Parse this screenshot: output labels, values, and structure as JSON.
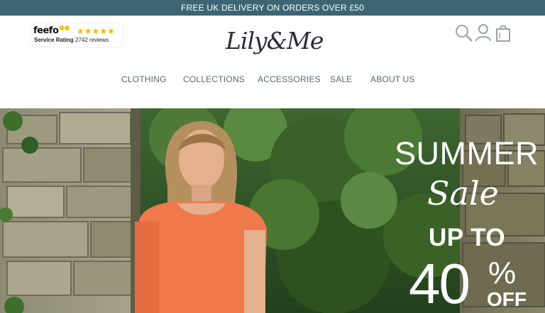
{
  "announcement": {
    "text": "FREE UK DELIVERY ON ORDERS OVER £50"
  },
  "feefo": {
    "logo": "feefo",
    "label": "Service Rating",
    "stars": "★★★★★",
    "reviews": "2742 reviews"
  },
  "brand": {
    "logo_text": "Lily&Me"
  },
  "header_icons": [
    "search-icon",
    "account-icon",
    "shopping-bag-icon"
  ],
  "nav": {
    "items": [
      {
        "label": "CLOTHING"
      },
      {
        "label": "COLLECTIONS"
      },
      {
        "label": "ACCESSORIES"
      },
      {
        "label": "SALE"
      },
      {
        "label": "ABOUT US"
      }
    ]
  },
  "hero": {
    "headline": "SUMMER",
    "script": "Sale",
    "up_to": "UP TO",
    "percent": "40",
    "percent_sign": "%",
    "off": "OFF"
  },
  "colors": {
    "announcement_bg": "#3d6674",
    "nav_text": "#5a6670",
    "icon_stroke": "#9aa3ab"
  }
}
